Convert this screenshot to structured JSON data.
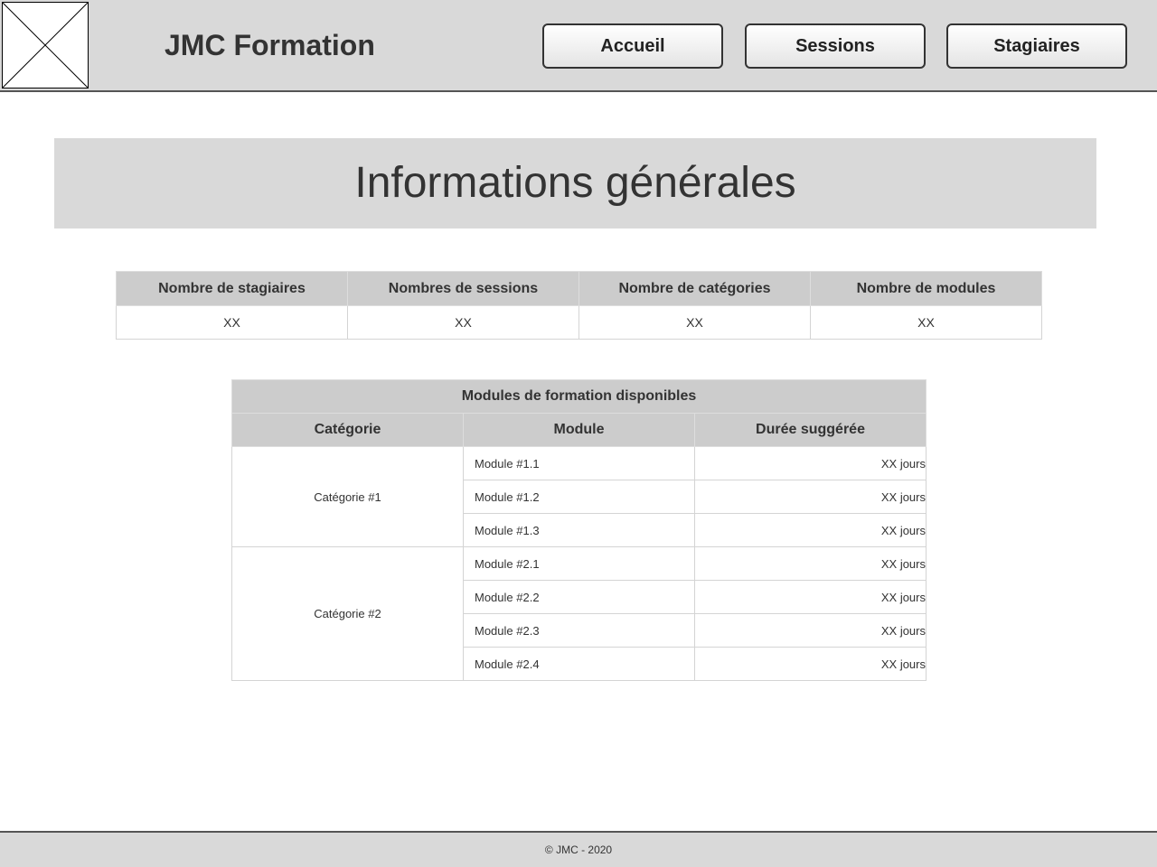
{
  "header": {
    "logo_icon": "image-placeholder-icon",
    "site_title": "JMC Formation",
    "nav": {
      "accueil": "Accueil",
      "sessions": "Sessions",
      "stagiaires": "Stagiaires"
    }
  },
  "main": {
    "title": "Informations générales",
    "stats": {
      "headers": [
        "Nombre de stagiaires",
        "Nombres de sessions",
        "Nombre de catégories",
        "Nombre de modules"
      ],
      "values": [
        "XX",
        "XX",
        "XX",
        "XX"
      ]
    },
    "modules_table": {
      "caption": "Modules de formation disponibles",
      "headers": [
        "Catégorie",
        "Module",
        "Durée suggérée"
      ],
      "categories": [
        {
          "name": "Catégorie #1",
          "modules": [
            {
              "name": "Module #1.1",
              "duration": "XX jours"
            },
            {
              "name": "Module #1.2",
              "duration": "XX jours"
            },
            {
              "name": "Module #1.3",
              "duration": "XX jours"
            }
          ]
        },
        {
          "name": "Catégorie #2",
          "modules": [
            {
              "name": "Module #2.1",
              "duration": "XX jours"
            },
            {
              "name": "Module #2.2",
              "duration": "XX jours"
            },
            {
              "name": "Module #2.3",
              "duration": "XX jours"
            },
            {
              "name": "Module #2.4",
              "duration": "XX jours"
            }
          ]
        }
      ]
    }
  },
  "footer": {
    "copyright": "© JMC - 2020"
  }
}
